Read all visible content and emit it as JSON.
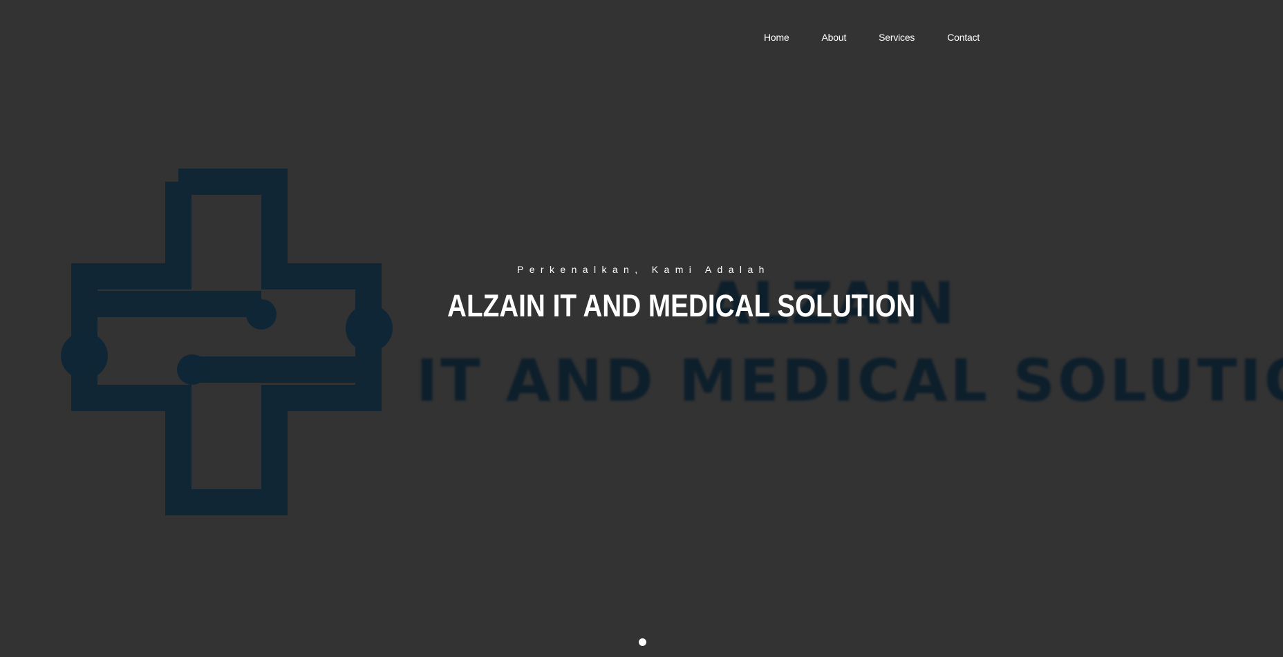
{
  "nav": {
    "items": [
      {
        "label": "Home"
      },
      {
        "label": "About"
      },
      {
        "label": "Services"
      },
      {
        "label": "Contact"
      }
    ]
  },
  "hero": {
    "subtitle": "Perkenalkan, Kami Adalah",
    "title": "ALZAIN IT AND MEDICAL SOLUTION"
  },
  "background_logo": {
    "line1": "ALZAIN",
    "line2": "IT AND MEDICAL SOLUTION",
    "icon": "medical-cross-circuit-icon",
    "color": "#0f2636"
  },
  "colors": {
    "background": "#333333",
    "text": "#ffffff",
    "logo": "#0f2636"
  },
  "slider": {
    "slides": 1,
    "active": 1
  }
}
